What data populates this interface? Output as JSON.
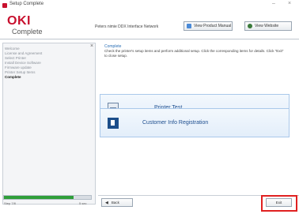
{
  "window": {
    "title": "Setup Complete",
    "minimize": "–",
    "close": "×"
  },
  "header": {
    "logo": "OKI",
    "subtitle": "Complete",
    "model": "Peters nimie DDX  Interface Network",
    "view_manual": "View Product Manual",
    "view_website": "View Website"
  },
  "sidebar": {
    "close": "×",
    "steps": [
      {
        "label": "Welcome",
        "active": false
      },
      {
        "label": "License and Agreement",
        "active": false
      },
      {
        "label": "Select Printer",
        "active": false
      },
      {
        "label": "Install Device Software",
        "active": false
      },
      {
        "label": "Firmware update",
        "active": false
      },
      {
        "label": "Printer Setup Items",
        "active": false
      },
      {
        "label": "Complete",
        "active": true
      }
    ],
    "progress": {
      "fraction": 0.8,
      "left_text": "Step 7/8",
      "right_text": "5 sec"
    }
  },
  "main": {
    "heading": "Complete",
    "description": "Check the printer's setup items and perform additional setup. Click the corresponding items for details. Click \"Exit\" to close setup.",
    "cards": [
      {
        "label": "Printer Test",
        "icon": "printer-icon"
      },
      {
        "label": "Customer Info Registration",
        "icon": "register-icon"
      }
    ]
  },
  "footer": {
    "back": "Back",
    "exit": "Exit"
  },
  "colors": {
    "brand": "#c8102e",
    "accent": "#2b6fb5",
    "progress": "#2f9e3a",
    "highlight": "#e02020"
  }
}
